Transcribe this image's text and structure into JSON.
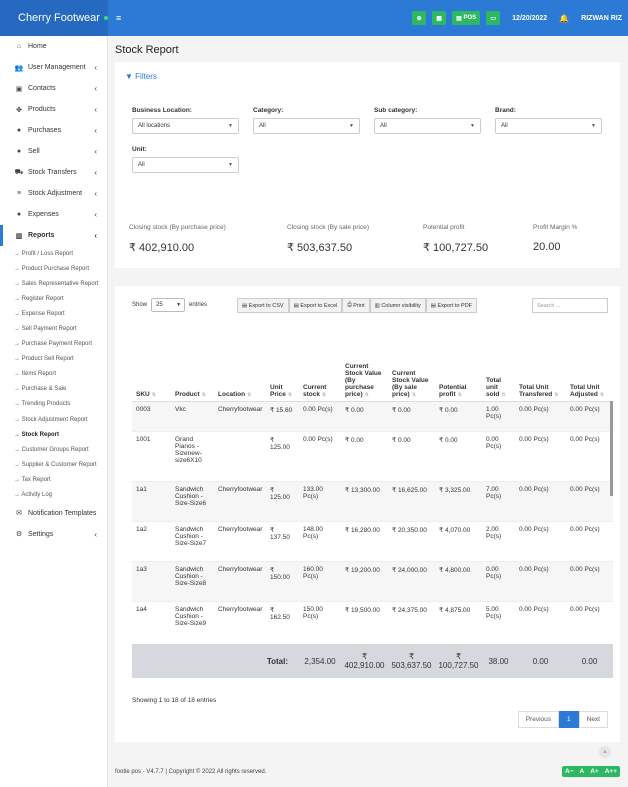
{
  "topbar": {
    "brand": "Cherry Footwear",
    "menu_glyph": "≡",
    "pos_label": "POS",
    "date": "12/20/2022",
    "user": "RIZWAN RIZ",
    "bell_glyph": "🔔",
    "icons": [
      "plus-circle-icon",
      "calculator-icon",
      "pos-icon",
      "money-icon",
      "bell-icon"
    ]
  },
  "sidebar": {
    "items": [
      {
        "label": "Home",
        "icon": "⌂",
        "chev": ""
      },
      {
        "label": "User Management",
        "icon": "👥",
        "chev": "‹"
      },
      {
        "label": "Contacts",
        "icon": "▣",
        "chev": "‹"
      },
      {
        "label": "Products",
        "icon": "✤",
        "chev": "‹"
      },
      {
        "label": "Purchases",
        "icon": "●",
        "chev": "‹"
      },
      {
        "label": "Sell",
        "icon": "●",
        "chev": "‹"
      },
      {
        "label": "Stock Transfers",
        "icon": "⛟",
        "chev": "‹"
      },
      {
        "label": "Stock Adjustment",
        "icon": "≡",
        "chev": "‹"
      },
      {
        "label": "Expenses",
        "icon": "●",
        "chev": "‹"
      },
      {
        "label": "Reports",
        "icon": "▥",
        "chev": "‹"
      }
    ],
    "sub_items": [
      "→ Profit / Loss Report",
      "→ Product Purchase Report",
      "→ Sales Representative Report",
      "→ Register Report",
      "→ Expense Report",
      "→ Sell Payment Report",
      "→ Purchase Payment Report",
      "→ Product Sell Report",
      "→ Items Report",
      "→ Purchase & Sale",
      "→ Trending Products",
      "→ Stock Adjustment Report",
      "→ Stock Report",
      "→ Customer Groups Report",
      "→ Supplier & Customer Report",
      "→ Tax Report",
      "→ Activity Log"
    ],
    "after_items": [
      {
        "label": "Notification Templates",
        "icon": "✉",
        "chev": ""
      },
      {
        "label": "Settings",
        "icon": "⚙",
        "chev": "‹"
      }
    ]
  },
  "page": {
    "title": "Stock Report"
  },
  "filters": {
    "title": "Filters",
    "icon": "▼",
    "fields": [
      {
        "label": "Business Location:",
        "value": "All locations"
      },
      {
        "label": "Category:",
        "value": "All"
      },
      {
        "label": "Sub category:",
        "value": "All"
      },
      {
        "label": "Brand:",
        "value": "All"
      },
      {
        "label": "Unit:",
        "value": "All"
      }
    ]
  },
  "stats": [
    {
      "label": "Closing stock (By purchase price)",
      "value": "₹ 402,910.00"
    },
    {
      "label": "Closing stock (By sale price)",
      "value": "₹ 503,637.50"
    },
    {
      "label": "Potential profit",
      "value": "₹ 100,727.50"
    },
    {
      "label": "Profit Margin %",
      "value": "20.00"
    }
  ],
  "table_tools": {
    "show": "Show",
    "entries_value": "25",
    "entries": "entries",
    "buttons": [
      "Export to CSV",
      "Export to Excel",
      "Print",
      "Column visibility",
      "Export to PDF"
    ],
    "search_placeholder": "Search ..."
  },
  "table": {
    "headers": [
      "SKU",
      "Product",
      "Location",
      "Unit Price",
      "Current stock",
      "Current Stock Value (By purchase price)",
      "Current Stock Value (By sale price)",
      "Potential profit",
      "Total unit sold",
      "Total Unit Transfered",
      "Total Unit Adjusted"
    ],
    "rows": [
      [
        "0003",
        "Vkc",
        "Cherryfootwear",
        "₹ 15.60",
        "0.00 Pc(s)",
        "₹ 0.00",
        "₹ 0.00",
        "₹ 0.00",
        "1.00 Pc(s)",
        "0.00 Pc(s)",
        "0.00 Pc(s)"
      ],
      [
        "1001",
        "Grand Pianos - Sizenew-size6X10",
        "",
        "₹ 125.00",
        "0.00 Pc(s)",
        "₹ 0.00",
        "₹ 0.00",
        "₹ 0.00",
        "0.00 Pc(s)",
        "0.00 Pc(s)",
        "0.00 Pc(s)"
      ],
      [
        "1a1",
        "Sandwich Cushion - Size-Size6",
        "Cherryfootwear",
        "₹ 125.00",
        "133.00 Pc(s)",
        "₹ 13,300.00",
        "₹ 16,625.00",
        "₹ 3,325.00",
        "7.00 Pc(s)",
        "0.00 Pc(s)",
        "0.00 Pc(s)"
      ],
      [
        "1a2",
        "Sandwich Cushion - Size-Size7",
        "Cherryfootwear",
        "₹ 137.50",
        "148.00 Pc(s)",
        "₹ 16,280.00",
        "₹ 20,350.00",
        "₹ 4,070.00",
        "2.00 Pc(s)",
        "0.00 Pc(s)",
        "0.00 Pc(s)"
      ],
      [
        "1a3",
        "Sandwich Cushion - Size-Size8",
        "Cherryfootwear",
        "₹ 150.00",
        "160.00 Pc(s)",
        "₹ 19,200.00",
        "₹ 24,000.00",
        "₹ 4,800.00",
        "0.00 Pc(s)",
        "0.00 Pc(s)",
        "0.00 Pc(s)"
      ],
      [
        "1a4",
        "Sandwich Cushion - Size-Size9",
        "Cherryfootwear",
        "₹ 162.50",
        "150.00 Pc(s)",
        "₹ 19,500.00",
        "₹ 24,375.00",
        "₹ 4,875.00",
        "5.00 Pc(s)",
        "0.00 Pc(s)",
        "0.00 Pc(s)"
      ]
    ],
    "footer": {
      "label": "Total:",
      "stock": "2,354.00",
      "value_purchase": "₹ 402,910.00",
      "value_sale": "₹ 503,637.50",
      "profit": "₹ 100,727.50",
      "sold": "38.00",
      "transfered": "0.00",
      "adjusted": "0.00"
    }
  },
  "table_info": "Showing 1 to 18 of 18 entries",
  "pagination": {
    "previous": "Previous",
    "current": "1",
    "next": "Next"
  },
  "footer": {
    "copyright": "footie pos - V4.7.7 | Copyright © 2022 All rights reserved.",
    "font_sizes": [
      "A−",
      "A",
      "A+",
      "A++"
    ]
  },
  "colors": {
    "primary": "#2b7bd6",
    "success": "#2fb864"
  }
}
